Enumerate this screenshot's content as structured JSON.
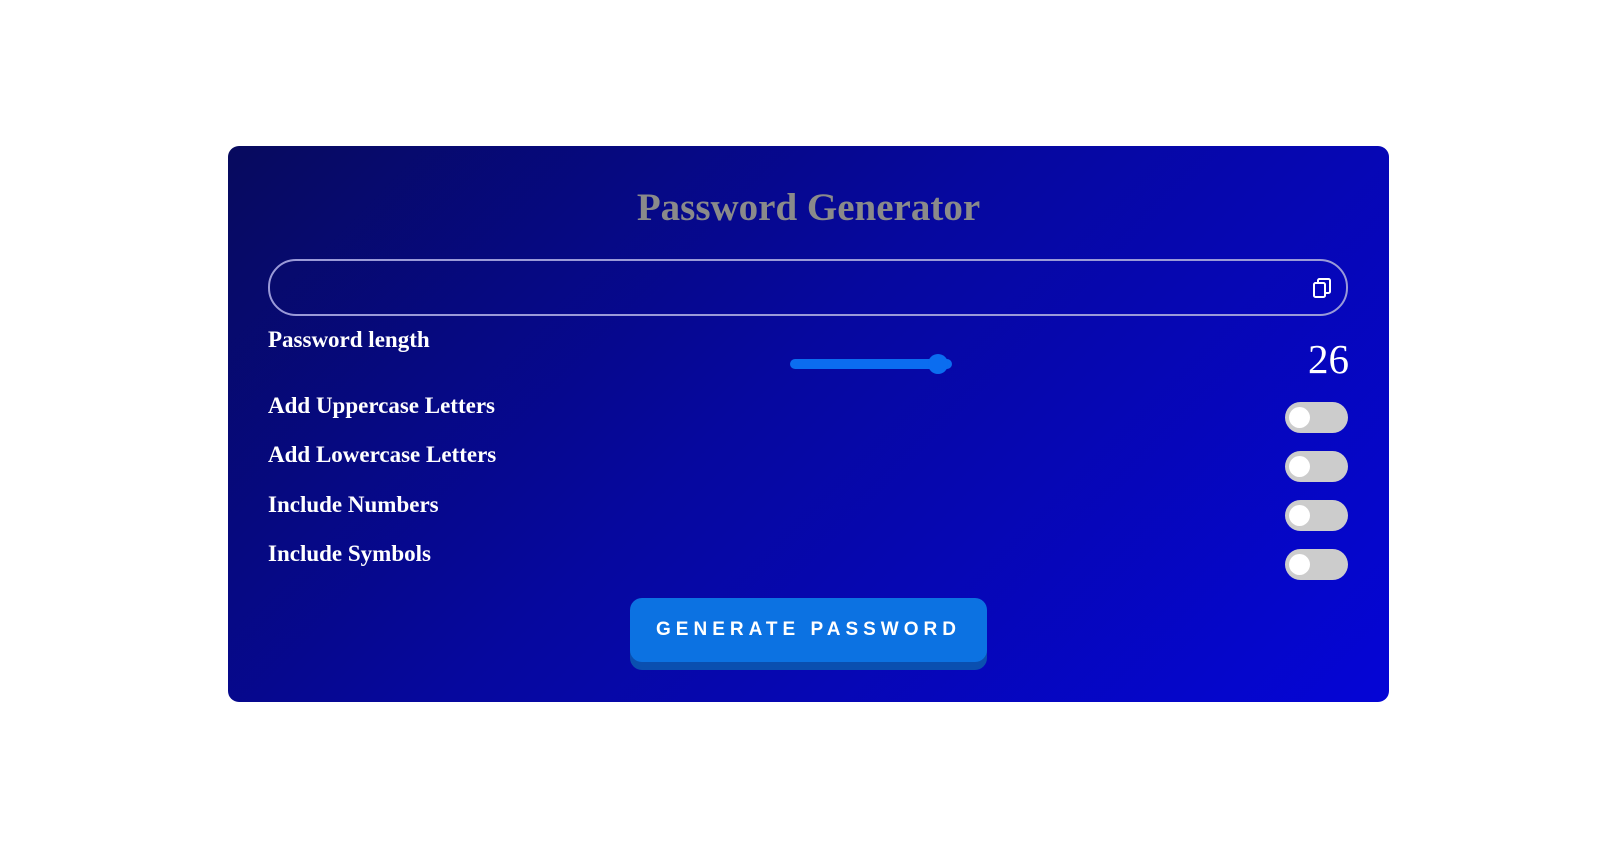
{
  "app": {
    "title": "Password Generator"
  },
  "output": {
    "value": "",
    "copy_icon": "copy-icon"
  },
  "length": {
    "label": "Password length",
    "value": "26",
    "slider_fraction": 0.97
  },
  "options": [
    {
      "label": "Add Uppercase Letters",
      "checked": false
    },
    {
      "label": "Add Lowercase Letters",
      "checked": false
    },
    {
      "label": "Include Numbers",
      "checked": false
    },
    {
      "label": "Include Symbols",
      "checked": false
    }
  ],
  "actions": {
    "generate_label": "GENERATE PASSWORD"
  },
  "colors": {
    "card_gradient_start": "#070a5e",
    "card_gradient_end": "#0505d6",
    "accent": "#0c72e2",
    "title": "#8a8a8a",
    "toggle_off": "#cccccc"
  }
}
